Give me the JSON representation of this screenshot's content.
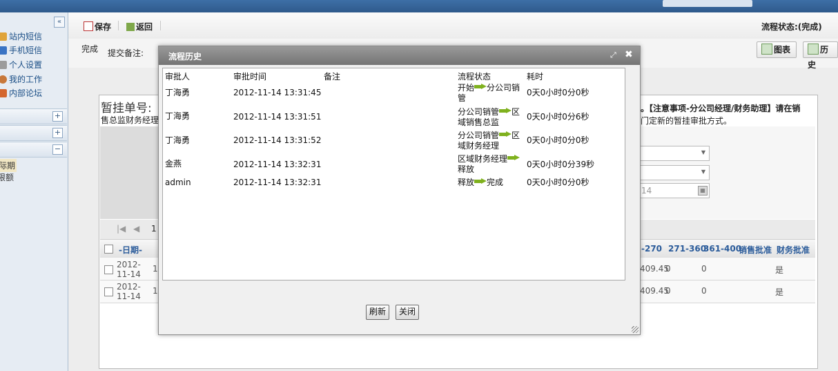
{
  "toolbar": {
    "save_label": "保存",
    "back_label": "返回",
    "status_text": "流程状态:(完成)"
  },
  "row2": {
    "done_label": "完成",
    "remark_label": "提交备注:"
  },
  "right_buttons": {
    "chart_label": "图表",
    "history_label": "历史"
  },
  "sidebar": {
    "collapse_glyph": "«",
    "items": [
      {
        "label": "站内短信",
        "icon": "mail-icon",
        "color": "#e0a43a"
      },
      {
        "label": "手机短信",
        "icon": "phone-icon",
        "color": "#3a74c4"
      },
      {
        "label": "个人设置",
        "icon": "pencil-icon",
        "color": "#8c8c8c"
      },
      {
        "label": "我的工作",
        "icon": "user-icon",
        "color": "#c8783a"
      },
      {
        "label": "内部论坛",
        "icon": "house-icon",
        "color": "#d4662e"
      }
    ],
    "section_toggles": [
      "+",
      "+",
      "−"
    ],
    "sub_items": [
      "际期",
      "限额"
    ]
  },
  "panel": {
    "title": "暂挂单号:",
    "subtitle_left": "售总监财务经理",
    "notice_right_1": "。【注意事项-分公司经理/财务助理】请在销",
    "notice_right_2": "门定新的暂挂审批方式。",
    "date_partial": "14"
  },
  "grid": {
    "pager_page": "1",
    "headers_left": [
      "-日期-"
    ],
    "headers_right": [
      "-270",
      "271-360",
      "361-400",
      "销售批准",
      "财务批准"
    ],
    "rows": [
      {
        "date": "2012-11-14",
        "col_a": "1",
        "amount": "409.45",
        "v1": "0",
        "v2": "0",
        "fin": "是"
      },
      {
        "date": "2012-11-14",
        "col_a": "1",
        "amount": "409.45",
        "v1": "0",
        "v2": "0",
        "fin": "是"
      }
    ]
  },
  "modal": {
    "title": "流程历史",
    "columns": [
      "审批人",
      "审批时间",
      "备注",
      "流程状态",
      "耗时"
    ],
    "rows": [
      {
        "approver": "丁海勇",
        "time": "2012-11-14 13:31:45",
        "remark": "",
        "from": "开始",
        "to": "分公司销管",
        "duration": "0天0小时0分0秒"
      },
      {
        "approver": "丁海勇",
        "time": "2012-11-14 13:31:51",
        "remark": "",
        "from": "分公司销管",
        "to": "区域销售总监",
        "duration": "0天0小时0分6秒"
      },
      {
        "approver": "丁海勇",
        "time": "2012-11-14 13:31:52",
        "remark": "",
        "from": "分公司销管",
        "to": "区域财务经理",
        "duration": "0天0小时0分0秒"
      },
      {
        "approver": "金燕",
        "time": "2012-11-14 13:32:31",
        "remark": "",
        "from": "区域财务经理",
        "to": "释放",
        "duration": "0天0小时0分39秒"
      },
      {
        "approver": "admin",
        "time": "2012-11-14 13:32:31",
        "remark": "",
        "from": "释放",
        "to": "完成",
        "duration": "0天0小时0分0秒"
      }
    ],
    "refresh_label": "刷新",
    "close_label": "关闭"
  }
}
